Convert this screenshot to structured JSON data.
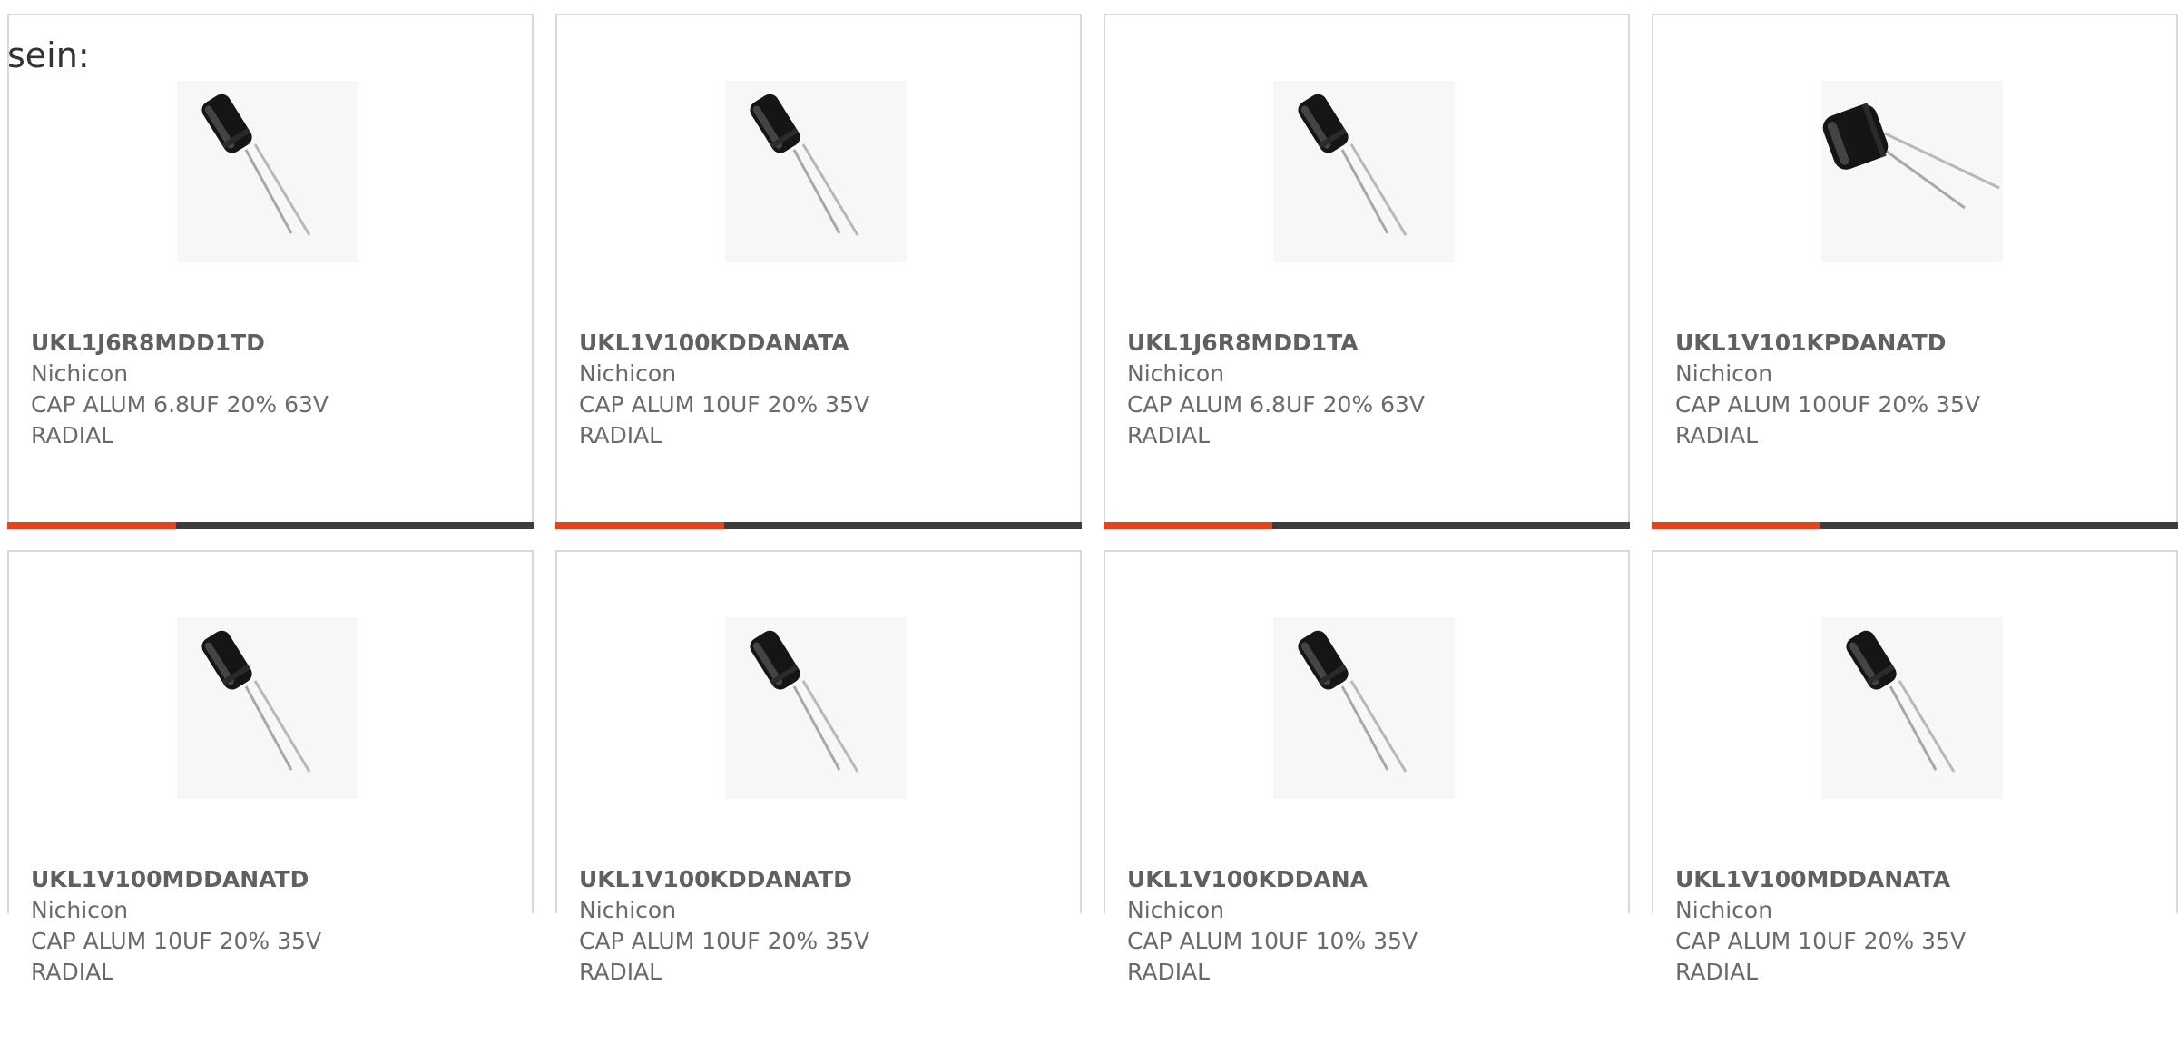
{
  "intro_text": "sein:",
  "colors": {
    "accent": "#e8421c",
    "bar_dark": "#3c3c3c",
    "card_border": "#d9d9d9",
    "text": "#6a6a6a"
  },
  "products": [
    {
      "part_number": "UKL1J6R8MDD1TD",
      "manufacturer": "Nichicon",
      "desc_line1": "CAP ALUM 6.8UF 20% 63V",
      "desc_line2": "RADIAL",
      "image_icon": "radial-capacitor-icon",
      "progress": 0.32
    },
    {
      "part_number": "UKL1V100KDDANATA",
      "manufacturer": "Nichicon",
      "desc_line1": "CAP ALUM 10UF 20% 35V",
      "desc_line2": "RADIAL",
      "image_icon": "radial-capacitor-icon",
      "progress": 0.32
    },
    {
      "part_number": "UKL1J6R8MDD1TA",
      "manufacturer": "Nichicon",
      "desc_line1": "CAP ALUM 6.8UF 20% 63V",
      "desc_line2": "RADIAL",
      "image_icon": "radial-capacitor-icon",
      "progress": 0.32
    },
    {
      "part_number": "UKL1V101KPDANATD",
      "manufacturer": "Nichicon",
      "desc_line1": "CAP ALUM 100UF 20% 35V",
      "desc_line2": "RADIAL",
      "image_icon": "radial-capacitor-wide-icon",
      "progress": 0.32
    },
    {
      "part_number": "UKL1V100MDDANATD",
      "manufacturer": "Nichicon",
      "desc_line1": "CAP ALUM 10UF 20% 35V",
      "desc_line2": "RADIAL",
      "image_icon": "radial-capacitor-icon",
      "progress": null
    },
    {
      "part_number": "UKL1V100KDDANATD",
      "manufacturer": "Nichicon",
      "desc_line1": "CAP ALUM 10UF 20% 35V",
      "desc_line2": "RADIAL",
      "image_icon": "radial-capacitor-icon",
      "progress": null
    },
    {
      "part_number": "UKL1V100KDDANA",
      "manufacturer": "Nichicon",
      "desc_line1": "CAP ALUM 10UF 10% 35V",
      "desc_line2": "RADIAL",
      "image_icon": "radial-capacitor-icon",
      "progress": null
    },
    {
      "part_number": "UKL1V100MDDANATA",
      "manufacturer": "Nichicon",
      "desc_line1": "CAP ALUM 10UF 20% 35V",
      "desc_line2": "RADIAL",
      "image_icon": "radial-capacitor-icon",
      "progress": null
    }
  ]
}
